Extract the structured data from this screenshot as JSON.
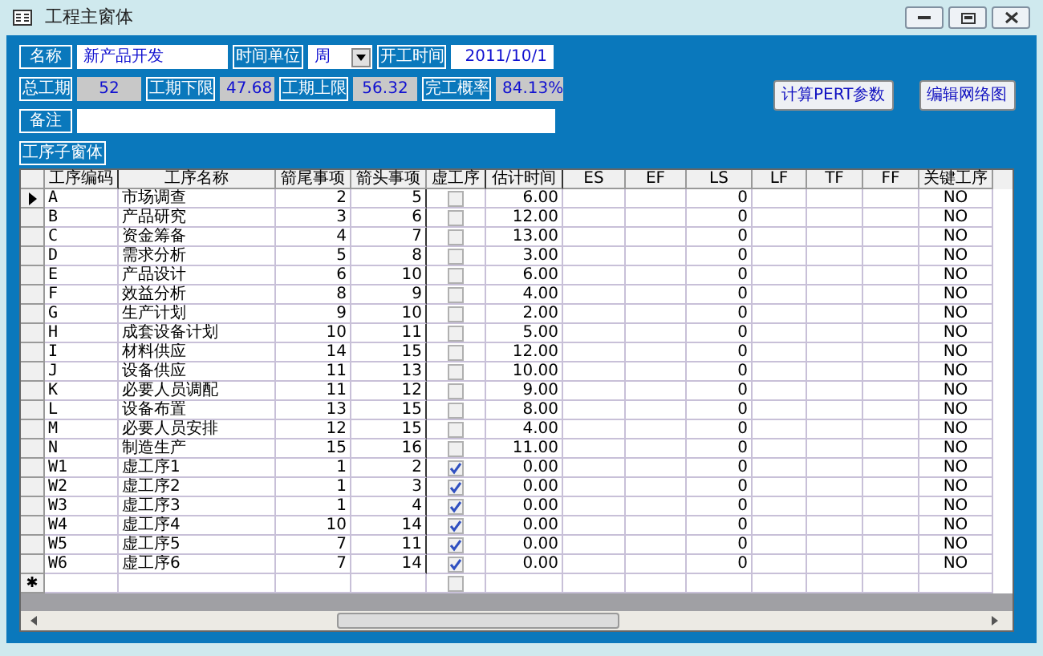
{
  "window": {
    "title": "工程主窗体"
  },
  "form": {
    "name_label": "名称",
    "name_value": "新产品开发",
    "unit_label": "时间单位",
    "unit_value": "周",
    "start_label": "开工时间",
    "start_value": "2011/10/1",
    "total_label": "总工期",
    "total_value": "52",
    "lower_label": "工期下限",
    "lower_value": "47.68",
    "upper_label": "工期上限",
    "upper_value": "56.32",
    "prob_label": "完工概率",
    "prob_value": "84.13%",
    "note_label": "备注",
    "subform_label": "工序子窗体"
  },
  "buttons": [
    "计算PERT参数",
    "编辑网络图"
  ],
  "table": {
    "columns": [
      "工序编码",
      "工序名称",
      "箭尾事项",
      "箭头事项",
      "虚工序",
      "估计时间",
      "ES",
      "EF",
      "LS",
      "LF",
      "TF",
      "FF",
      "关键工序"
    ],
    "new_row_marker": "✱",
    "new_row_dummy": false,
    "rows": [
      {
        "code": "A",
        "name": "市场调查",
        "tail": "2",
        "head": "5",
        "dummy": false,
        "time": "6.00",
        "ls": "0",
        "critical": "NO",
        "selected": true
      },
      {
        "code": "B",
        "name": "产品研究",
        "tail": "3",
        "head": "6",
        "dummy": false,
        "time": "12.00",
        "ls": "0",
        "critical": "NO",
        "selected": false
      },
      {
        "code": "C",
        "name": "资金筹备",
        "tail": "4",
        "head": "7",
        "dummy": false,
        "time": "13.00",
        "ls": "0",
        "critical": "NO",
        "selected": false
      },
      {
        "code": "D",
        "name": "需求分析",
        "tail": "5",
        "head": "8",
        "dummy": false,
        "time": "3.00",
        "ls": "0",
        "critical": "NO",
        "selected": false
      },
      {
        "code": "E",
        "name": "产品设计",
        "tail": "6",
        "head": "10",
        "dummy": false,
        "time": "6.00",
        "ls": "0",
        "critical": "NO",
        "selected": false
      },
      {
        "code": "F",
        "name": "效益分析",
        "tail": "8",
        "head": "9",
        "dummy": false,
        "time": "4.00",
        "ls": "0",
        "critical": "NO",
        "selected": false
      },
      {
        "code": "G",
        "name": "生产计划",
        "tail": "9",
        "head": "10",
        "dummy": false,
        "time": "2.00",
        "ls": "0",
        "critical": "NO",
        "selected": false
      },
      {
        "code": "H",
        "name": "成套设备计划",
        "tail": "10",
        "head": "11",
        "dummy": false,
        "time": "5.00",
        "ls": "0",
        "critical": "NO",
        "selected": false
      },
      {
        "code": "I",
        "name": "材料供应",
        "tail": "14",
        "head": "15",
        "dummy": false,
        "time": "12.00",
        "ls": "0",
        "critical": "NO",
        "selected": false
      },
      {
        "code": "J",
        "name": "设备供应",
        "tail": "11",
        "head": "13",
        "dummy": false,
        "time": "10.00",
        "ls": "0",
        "critical": "NO",
        "selected": false
      },
      {
        "code": "K",
        "name": "必要人员调配",
        "tail": "11",
        "head": "12",
        "dummy": false,
        "time": "9.00",
        "ls": "0",
        "critical": "NO",
        "selected": false
      },
      {
        "code": "L",
        "name": "设备布置",
        "tail": "13",
        "head": "15",
        "dummy": false,
        "time": "8.00",
        "ls": "0",
        "critical": "NO",
        "selected": false
      },
      {
        "code": "M",
        "name": "必要人员安排",
        "tail": "12",
        "head": "15",
        "dummy": false,
        "time": "4.00",
        "ls": "0",
        "critical": "NO",
        "selected": false
      },
      {
        "code": "N",
        "name": "制造生产",
        "tail": "15",
        "head": "16",
        "dummy": false,
        "time": "11.00",
        "ls": "0",
        "critical": "NO",
        "selected": false
      },
      {
        "code": "W1",
        "name": "虚工序1",
        "tail": "1",
        "head": "2",
        "dummy": true,
        "time": "0.00",
        "ls": "0",
        "critical": "NO",
        "selected": false
      },
      {
        "code": "W2",
        "name": "虚工序2",
        "tail": "1",
        "head": "3",
        "dummy": true,
        "time": "0.00",
        "ls": "0",
        "critical": "NO",
        "selected": false
      },
      {
        "code": "W3",
        "name": "虚工序3",
        "tail": "1",
        "head": "4",
        "dummy": true,
        "time": "0.00",
        "ls": "0",
        "critical": "NO",
        "selected": false
      },
      {
        "code": "W4",
        "name": "虚工序4",
        "tail": "10",
        "head": "14",
        "dummy": true,
        "time": "0.00",
        "ls": "0",
        "critical": "NO",
        "selected": false
      },
      {
        "code": "W5",
        "name": "虚工序5",
        "tail": "7",
        "head": "11",
        "dummy": true,
        "time": "0.00",
        "ls": "0",
        "critical": "NO",
        "selected": false
      },
      {
        "code": "W6",
        "name": "虚工序6",
        "tail": "7",
        "head": "14",
        "dummy": true,
        "time": "0.00",
        "ls": "0",
        "critical": "NO",
        "selected": false
      }
    ]
  }
}
